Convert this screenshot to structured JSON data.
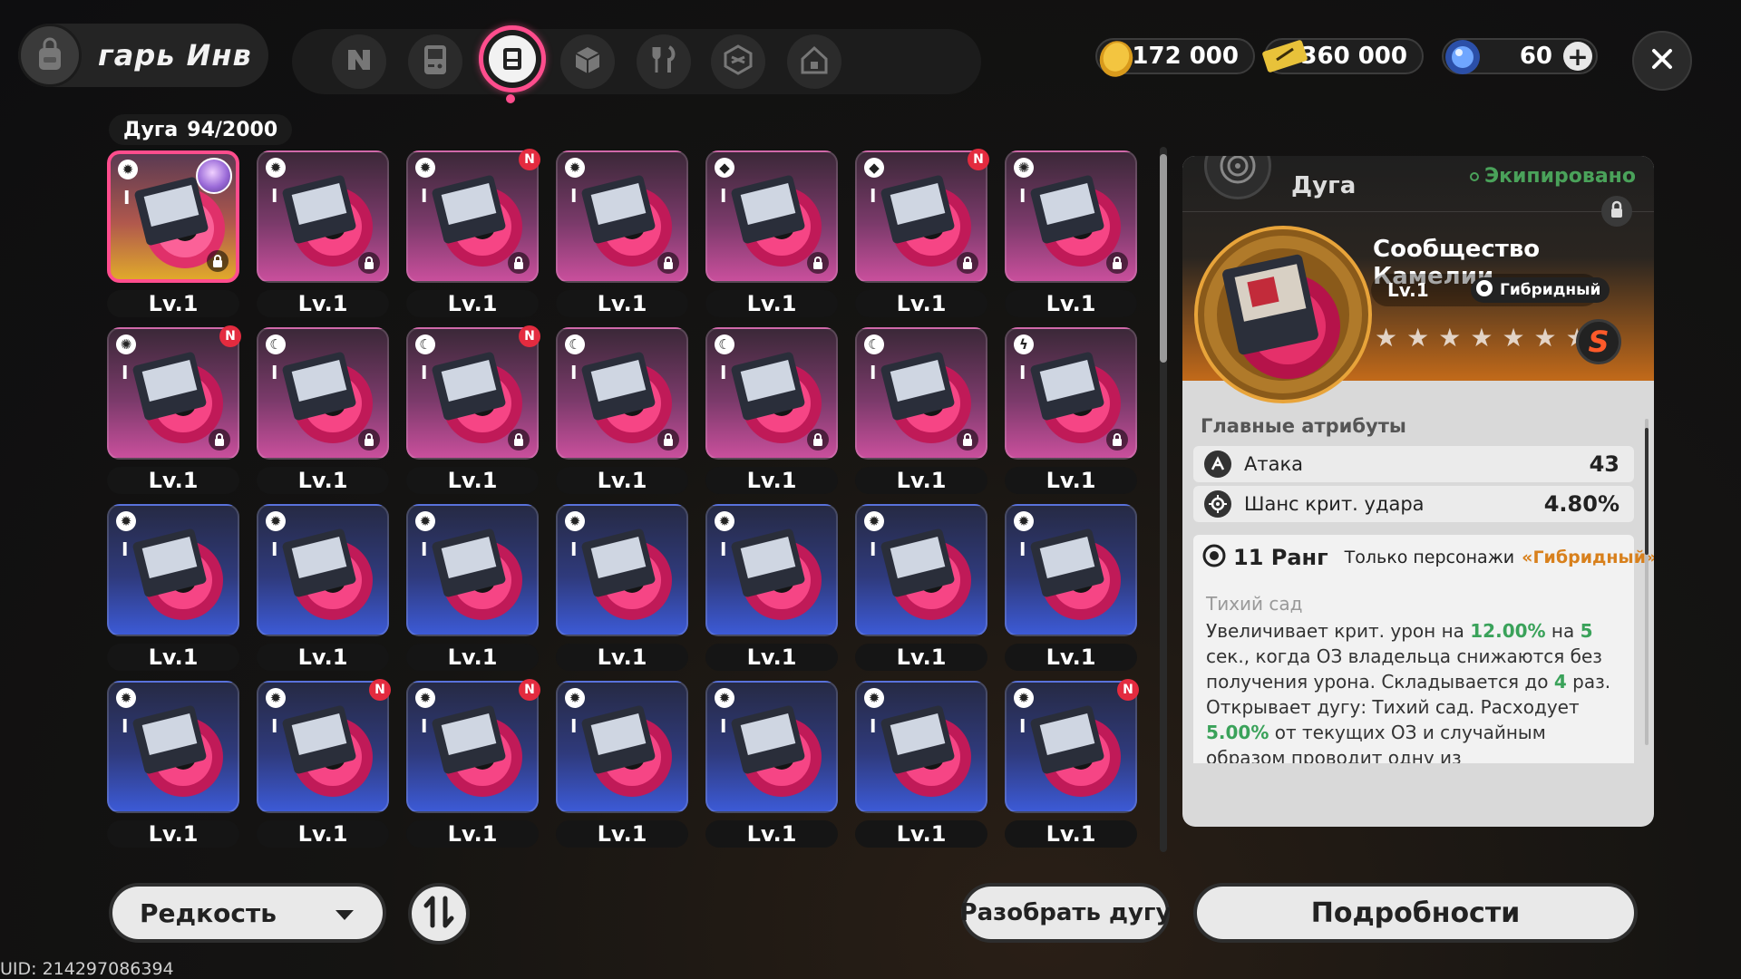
{
  "header": {
    "bag_title": "гарь  Инв",
    "nav_tabs": [
      {
        "icon": "n-logo-icon"
      },
      {
        "icon": "gameboy-icon"
      },
      {
        "icon": "arc-disc-icon",
        "active": true
      },
      {
        "icon": "cube-icon"
      },
      {
        "icon": "fork-knife-icon"
      },
      {
        "icon": "box-icon"
      },
      {
        "icon": "house-icon"
      }
    ],
    "currencies": [
      {
        "icon": "gold-coin-icon",
        "value": "172 000"
      },
      {
        "icon": "ticket-icon",
        "value": "360 000"
      },
      {
        "icon": "crystal-icon",
        "value": "60",
        "plus": "+"
      }
    ]
  },
  "inventory": {
    "category": "Дуга",
    "count": "94/2000",
    "level_label": "Lv.1",
    "roman_numeral": "I",
    "new_badge": "N",
    "rows": [
      [
        {
          "color": "gold",
          "type_icon": "gear",
          "selected": true,
          "avatar": true,
          "new": false
        },
        {
          "color": "pink",
          "type_icon": "gear",
          "new": false
        },
        {
          "color": "pink",
          "type_icon": "gear",
          "new": true
        },
        {
          "color": "pink",
          "type_icon": "gear",
          "new": false
        },
        {
          "color": "pink",
          "type_icon": "dice",
          "new": false
        },
        {
          "color": "pink",
          "type_icon": "dice",
          "new": true
        },
        {
          "color": "pink",
          "type_icon": "swirl",
          "new": false
        }
      ],
      [
        {
          "color": "pink",
          "type_icon": "swirl",
          "new": true
        },
        {
          "color": "pink",
          "type_icon": "moon",
          "new": false
        },
        {
          "color": "pink",
          "type_icon": "moon",
          "new": true
        },
        {
          "color": "pink",
          "type_icon": "moon",
          "new": false
        },
        {
          "color": "pink",
          "type_icon": "moon",
          "new": false
        },
        {
          "color": "pink",
          "type_icon": "moon",
          "new": false
        },
        {
          "color": "pink",
          "type_icon": "bolt",
          "new": false
        }
      ],
      [
        {
          "color": "blue",
          "type_icon": "gear",
          "new": false
        },
        {
          "color": "blue",
          "type_icon": "gear",
          "new": false
        },
        {
          "color": "blue",
          "type_icon": "gear",
          "new": false
        },
        {
          "color": "blue",
          "type_icon": "gear",
          "new": false
        },
        {
          "color": "blue",
          "type_icon": "gear",
          "new": false
        },
        {
          "color": "blue",
          "type_icon": "gear",
          "new": false
        },
        {
          "color": "blue",
          "type_icon": "gear",
          "new": false
        }
      ],
      [
        {
          "color": "blue",
          "type_icon": "gear",
          "new": false
        },
        {
          "color": "blue",
          "type_icon": "gear",
          "new": true
        },
        {
          "color": "blue",
          "type_icon": "gear",
          "new": true
        },
        {
          "color": "blue",
          "type_icon": "gear",
          "new": false
        },
        {
          "color": "blue",
          "type_icon": "gear",
          "new": false
        },
        {
          "color": "blue",
          "type_icon": "gear",
          "new": false
        },
        {
          "color": "blue",
          "type_icon": "gear",
          "new": true
        }
      ]
    ]
  },
  "footer": {
    "rarity_label": "Редкость",
    "disassemble_label": "Разобрать дугу",
    "details_label": "Подробности",
    "uid": "UID: 214297086394"
  },
  "detail": {
    "category": "Дуга",
    "status": "Экипировано",
    "name": "Сообщество Камелии",
    "level": "Lv.1",
    "type": "Гибридный",
    "stars": [
      "★",
      "★",
      "★",
      "★",
      "★",
      "★",
      "★"
    ],
    "rank_badge": "S",
    "main_attrs_title": "Главные атрибуты",
    "attrs": [
      {
        "icon": "attack-icon",
        "name": "Атака",
        "value": "43"
      },
      {
        "icon": "crit-icon",
        "name": "Шанс крит. удара",
        "value": "4.80%"
      }
    ],
    "rank": "11 Ранг",
    "rank_only": "Только персонажи",
    "rank_type": "«Гибридный»",
    "skill_name": "Тихий сад",
    "desc": {
      "p1": "Увеличивает крит. урон на ",
      "v1": "12.00%",
      "p2": " на ",
      "v2": "5",
      "p3": " сек., когда ОЗ владельца снижаются без получения урона. Складывается до ",
      "v3": "4",
      "p4": " раз. Открывает дугу: Тихий сад. Расходует ",
      "v4": "5.00%",
      "p5": " от текущих ОЗ и случайным образом проводит одну из"
    },
    "accent_color": "#d8801c",
    "green_color": "#3aa25a"
  }
}
